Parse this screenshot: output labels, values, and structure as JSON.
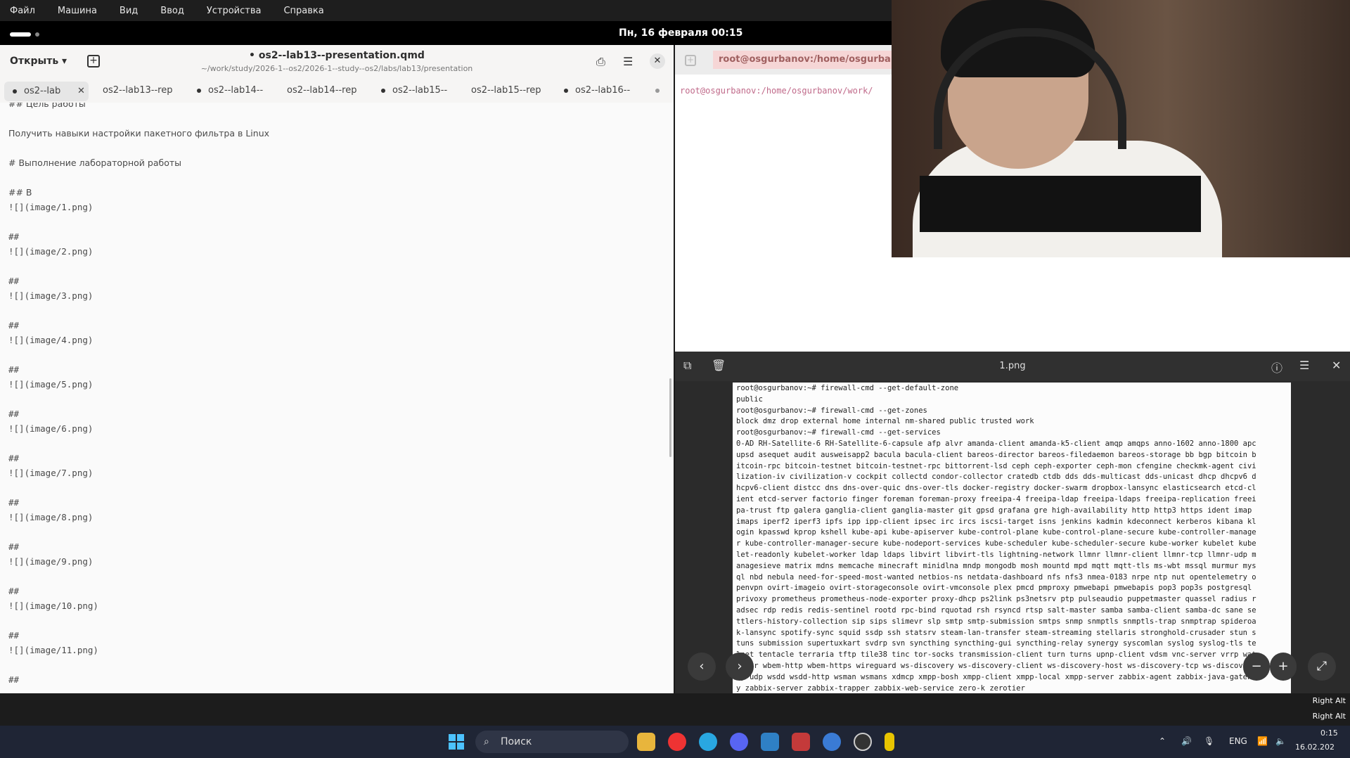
{
  "vm_menu": [
    "Файл",
    "Машина",
    "Вид",
    "Ввод",
    "Устройства",
    "Справка"
  ],
  "topbar": {
    "clock": "Пн, 16 февраля  00:15"
  },
  "editor": {
    "open_label": "Открыть",
    "title": "• os2--lab13--presentation.qmd",
    "path": "~/work/study/2026-1--os2/2026-1--study--os2/labs/lab13/presentation",
    "tabs": [
      "os2--lab",
      "os2--lab13--rep",
      "os2--lab14--",
      "os2--lab14--rep",
      "os2--lab15--",
      "os2--lab15--rep",
      "os2--lab16--",
      ""
    ],
    "lines": [
      "## Цель работы",
      "",
      "Получить навыки настройки пакетного фильтра в Linux",
      "",
      "# Выполнение лабораторной работы",
      "",
      "## В",
      "![](image/1.png)",
      "",
      "##",
      "![](image/2.png)",
      "",
      "##",
      "![](image/3.png)",
      "",
      "##",
      "![](image/4.png)",
      "",
      "##",
      "![](image/5.png)",
      "",
      "##",
      "![](image/6.png)",
      "",
      "##",
      "![](image/7.png)",
      "",
      "##",
      "![](image/8.png)",
      "",
      "##",
      "![](image/9.png)",
      "",
      "##",
      "![](image/10.png)",
      "",
      "##",
      "![](image/11.png)",
      "",
      "##"
    ]
  },
  "terminal": {
    "title": "root@osgurbanov:/home/osgurban",
    "prompt": "root@osgurbanov:/home/osgurbanov/work/"
  },
  "viewer": {
    "title": "1.png",
    "lines": [
      {
        "prompt": "root@osgurbanov:~#",
        "text": " firewall-cmd --get-default-zone"
      },
      {
        "prompt": "",
        "text": "public"
      },
      {
        "prompt": "root@osgurbanov:~#",
        "text": " firewall-cmd --get-zones"
      },
      {
        "prompt": "",
        "text": "block dmz drop external home internal nm-shared public trusted work"
      },
      {
        "prompt": "root@osgurbanov:~#",
        "text": " firewall-cmd --get-services"
      },
      {
        "prompt": "",
        "text": "0-AD RH-Satellite-6 RH-Satellite-6-capsule afp alvr amanda-client amanda-k5-client amqp amqps anno-1602 anno-1800 apc"
      },
      {
        "prompt": "",
        "text": "upsd asequet audit ausweisapp2 bacula bacula-client bareos-director bareos-filedaemon bareos-storage bb bgp bitcoin b"
      },
      {
        "prompt": "",
        "text": "itcoin-rpc bitcoin-testnet bitcoin-testnet-rpc bittorrent-lsd ceph ceph-exporter ceph-mon cfengine checkmk-agent civi"
      },
      {
        "prompt": "",
        "text": "lization-iv civilization-v cockpit collectd condor-collector cratedb ctdb dds dds-multicast dds-unicast dhcp dhcpv6 d"
      },
      {
        "prompt": "",
        "text": "hcpv6-client distcc dns dns-over-quic dns-over-tls docker-registry docker-swarm dropbox-lansync elasticsearch etcd-cl"
      },
      {
        "prompt": "",
        "text": "ient etcd-server factorio finger foreman foreman-proxy freeipa-4 freeipa-ldap freeipa-ldaps freeipa-replication freei"
      },
      {
        "prompt": "",
        "text": "pa-trust ftp galera ganglia-client ganglia-master git gpsd grafana gre high-availability http http3 https ident imap"
      },
      {
        "prompt": "",
        "text": "imaps iperf2 iperf3 ipfs ipp ipp-client ipsec irc ircs iscsi-target isns jenkins kadmin kdeconnect kerberos kibana kl"
      },
      {
        "prompt": "",
        "text": "ogin kpasswd kprop kshell kube-api kube-apiserver kube-control-plane kube-control-plane-secure kube-controller-manage"
      },
      {
        "prompt": "",
        "text": "r kube-controller-manager-secure kube-nodeport-services kube-scheduler kube-scheduler-secure kube-worker kubelet kube"
      },
      {
        "prompt": "",
        "text": "let-readonly kubelet-worker ldap ldaps libvirt libvirt-tls lightning-network llmnr llmnr-client llmnr-tcp llmnr-udp m"
      },
      {
        "prompt": "",
        "text": "anagesieve matrix mdns memcache minecraft minidlna mndp mongodb mosh mountd mpd mqtt mqtt-tls ms-wbt mssql murmur mys"
      },
      {
        "prompt": "",
        "text": "ql nbd nebula need-for-speed-most-wanted netbios-ns netdata-dashboard nfs nfs3 nmea-0183 nrpe ntp nut opentelemetry o"
      },
      {
        "prompt": "",
        "text": "penvpn ovirt-imageio ovirt-storageconsole ovirt-vmconsole plex pmcd pmproxy pmwebapi pmwebapis pop3 pop3s postgresql"
      },
      {
        "prompt": "",
        "text": "privoxy prometheus prometheus-node-exporter proxy-dhcp ps2link ps3netsrv ptp pulseaudio puppetmaster quassel radius r"
      },
      {
        "prompt": "",
        "text": "adsec rdp redis redis-sentinel rootd rpc-bind rquotad rsh rsyncd rtsp salt-master samba samba-client samba-dc sane se"
      },
      {
        "prompt": "",
        "text": "ttlers-history-collection sip sips slimevr slp smtp smtp-submission smtps snmp snmptls snmptls-trap snmptrap spideroa"
      },
      {
        "prompt": "",
        "text": "k-lansync spotify-sync squid ssdp ssh statsrv steam-lan-transfer steam-streaming stellaris stronghold-crusader stun s"
      },
      {
        "prompt": "",
        "text": "tuns submission supertuxkart svdrp svn syncthing syncthing-gui syncthing-relay synergy syscomlan syslog syslog-tls te"
      },
      {
        "prompt": "",
        "text": "lnet tentacle terraria tftp tile38 tinc tor-socks transmission-client turn turns upnp-client vdsm vnc-server vrrp wat"
      },
      {
        "prompt": "",
        "text": "chtor wbem-http wbem-https wireguard ws-discovery ws-discovery-client ws-discovery-host ws-discovery-tcp ws-discove"
      },
      {
        "prompt": "",
        "text": "ry-udp wsdd wsdd-http wsman wsmans xdmcp xmpp-bosh xmpp-client xmpp-local xmpp-server zabbix-agent zabbix-java-gatew"
      },
      {
        "prompt": "",
        "text": "y zabbix-server zabbix-trapper zabbix-web-service zero-k zerotier"
      }
    ]
  },
  "vm_status": "Right Alt",
  "taskbar": {
    "search_label": "Поиск",
    "lang": "ENG",
    "time": "0:15",
    "date": "16.02.202"
  },
  "colors": {
    "accent": "#4cc2ff",
    "prompt": "#b96d95",
    "terminal_tab": "#f6d6d6"
  }
}
